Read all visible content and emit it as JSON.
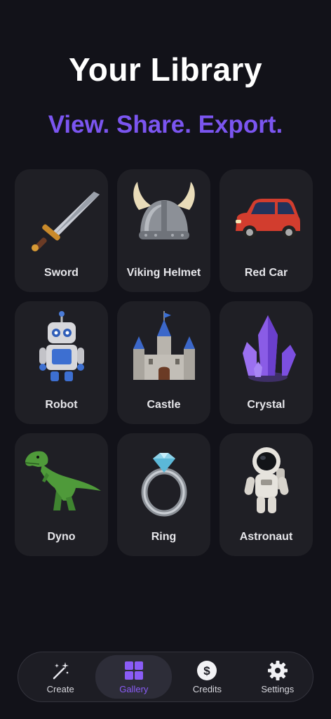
{
  "header": {
    "title": "Your Library",
    "subtitle": "View. Share. Export."
  },
  "gallery": {
    "items": [
      {
        "label": "Sword",
        "icon": "sword-icon"
      },
      {
        "label": "Viking Helmet",
        "icon": "viking-helmet-icon"
      },
      {
        "label": "Red Car",
        "icon": "red-car-icon"
      },
      {
        "label": "Robot",
        "icon": "robot-icon"
      },
      {
        "label": "Castle",
        "icon": "castle-icon"
      },
      {
        "label": "Crystal",
        "icon": "crystal-icon"
      },
      {
        "label": "Dyno",
        "icon": "dinosaur-icon"
      },
      {
        "label": "Ring",
        "icon": "ring-icon"
      },
      {
        "label": "Astronaut",
        "icon": "astronaut-icon"
      }
    ]
  },
  "nav": {
    "items": [
      {
        "label": "Create",
        "icon": "magic-wand-icon",
        "active": false
      },
      {
        "label": "Gallery",
        "icon": "grid-icon",
        "active": true
      },
      {
        "label": "Credits",
        "icon": "dollar-coin-icon",
        "active": false
      },
      {
        "label": "Settings",
        "icon": "gear-icon",
        "active": false
      }
    ]
  },
  "colors": {
    "background": "#121219",
    "accent": "#7b55f0",
    "tile": "#1f1f25"
  }
}
